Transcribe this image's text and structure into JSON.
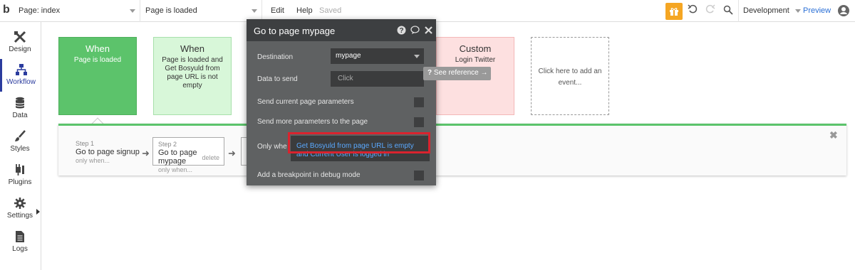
{
  "topbar": {
    "logo": "b",
    "page_select": "Page: index",
    "event_select": "Page is loaded",
    "menu_edit": "Edit",
    "menu_help": "Help",
    "saved": "Saved",
    "env_select": "Development",
    "preview": "Preview"
  },
  "sidebar": {
    "items": [
      {
        "label": "Design",
        "icon": "design-icon"
      },
      {
        "label": "Workflow",
        "icon": "workflow-icon"
      },
      {
        "label": "Data",
        "icon": "database-icon"
      },
      {
        "label": "Styles",
        "icon": "brush-icon"
      },
      {
        "label": "Plugins",
        "icon": "plug-icon"
      },
      {
        "label": "Settings",
        "icon": "gear-icon"
      },
      {
        "label": "Logs",
        "icon": "document-icon"
      }
    ]
  },
  "events": [
    {
      "title": "When",
      "text": "Page is loaded"
    },
    {
      "title": "When",
      "text": "Page is loaded and Get Bosyuld from page URL is not empty"
    },
    {
      "title": "Custom",
      "text": "Login Twitter"
    },
    {
      "title": "",
      "text": "Click here to add an event..."
    }
  ],
  "steps": [
    {
      "num": "Step 1",
      "title": "Go to page signup",
      "sub": "only when..."
    },
    {
      "num": "Step 2",
      "title": "Go to page mypage",
      "sub": "only when...",
      "delete": "delete"
    }
  ],
  "panel": {
    "title": "Go to page mypage",
    "destination_label": "Destination",
    "destination_value": "mypage",
    "data_label": "Data to send",
    "data_placeholder": "Click",
    "send_current": "Send current page parameters",
    "send_more": "Send more parameters to the page",
    "only_when": "Only whe",
    "condition_line1": "Get Bosyuld from page URL is empty",
    "condition_line2": "and Current User is logged in",
    "breakpoint": "Add a breakpoint in debug mode"
  },
  "tooltip": {
    "text": "See reference →",
    "icon": "?"
  }
}
